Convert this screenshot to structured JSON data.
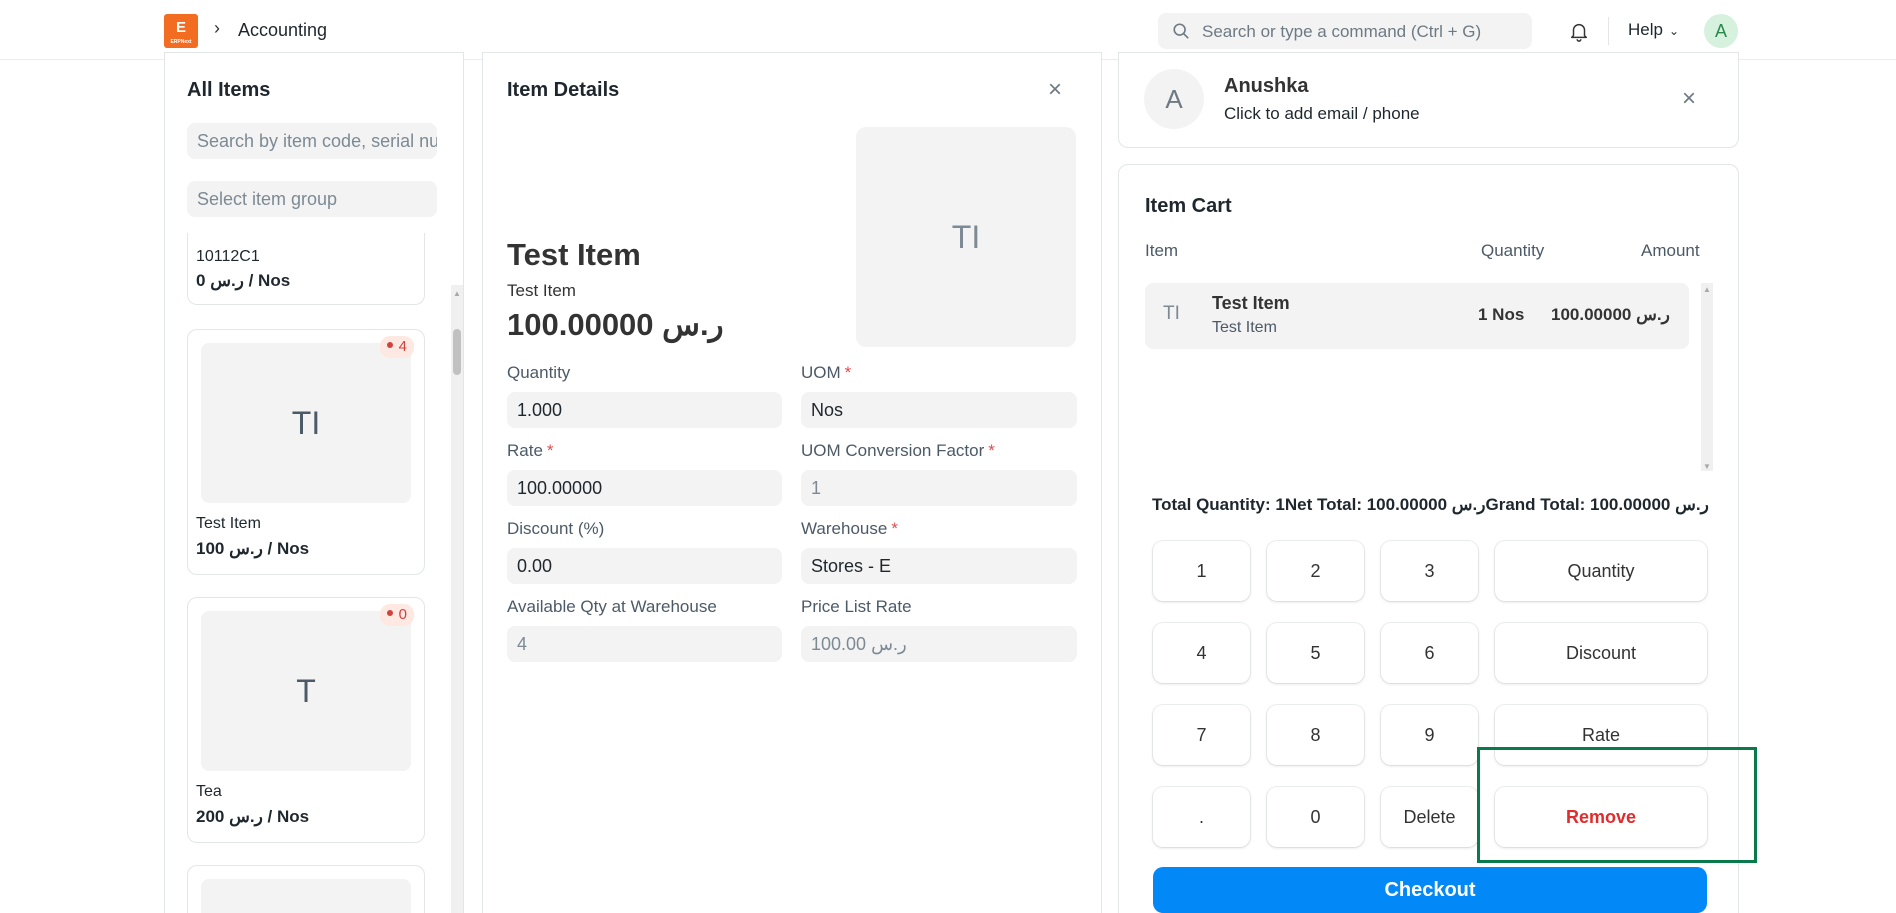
{
  "topbar": {
    "logo_text": "E",
    "logo_sub": "ERPNext",
    "breadcrumb": "Accounting",
    "search_placeholder": "Search or type a command (Ctrl + G)",
    "help_label": "Help",
    "avatar_letter": "A",
    "brand_color": "#f26c21"
  },
  "items_panel": {
    "title": "All Items",
    "search_placeholder": "Search by item code, serial number or barcode",
    "group_placeholder": "Select item group",
    "items": [
      {
        "name": "10112C1",
        "price": "0 ر.س / Nos"
      },
      {
        "initials": "TI",
        "stock": "4",
        "name": "Test Item",
        "price": "100 ر.س / Nos"
      },
      {
        "initials": "T",
        "stock": "0",
        "name": "Tea",
        "price": "200 ر.س / Nos"
      }
    ]
  },
  "details_panel": {
    "title": "Item Details",
    "item_name": "Test Item",
    "item_sub": "Test Item",
    "price": "100.00000 ر.س",
    "image_initials": "TI",
    "fields": {
      "quantity_label": "Quantity",
      "quantity_value": "1.000",
      "uom_label": "UOM",
      "uom_value": "Nos",
      "rate_label": "Rate",
      "rate_value": "100.00000",
      "uom_cf_label": "UOM Conversion Factor",
      "uom_cf_value": "1",
      "discount_label": "Discount (%)",
      "discount_value": "0.00",
      "warehouse_label": "Warehouse",
      "warehouse_value": "Stores - E",
      "avail_qty_label": "Available Qty at Warehouse",
      "avail_qty_value": "4",
      "plr_label": "Price List Rate",
      "plr_value": "100.00 ر.س",
      "required_mark": "*"
    }
  },
  "customer": {
    "avatar_letter": "A",
    "name": "Anushka",
    "contact_hint": "Click to add email / phone"
  },
  "cart": {
    "title": "Item Cart",
    "col_item": "Item",
    "col_qty": "Quantity",
    "col_amount": "Amount",
    "row": {
      "initials": "TI",
      "name": "Test Item",
      "sub": "Test Item",
      "qty": "1 Nos",
      "amount": "100.00000 ر.س"
    },
    "totals": "Total Quantity: 1Net Total: 100.00000 ر.سGrand Total: 100.00000 ر.س",
    "keys": {
      "k1": "1",
      "k2": "2",
      "k3": "3",
      "quantity": "Quantity",
      "k4": "4",
      "k5": "5",
      "k6": "6",
      "discount": "Discount",
      "k7": "7",
      "k8": "8",
      "k9": "9",
      "rate": "Rate",
      "dot": ".",
      "k0": "0",
      "delete": "Delete",
      "remove": "Remove"
    },
    "checkout_label": "Checkout",
    "checkout_color": "#0289f7",
    "remove_color": "#e02c2c",
    "highlight_color": "#0b7a4b"
  },
  "icons": {
    "close": "×",
    "chevron": "›",
    "chevron_down": "⌄"
  }
}
